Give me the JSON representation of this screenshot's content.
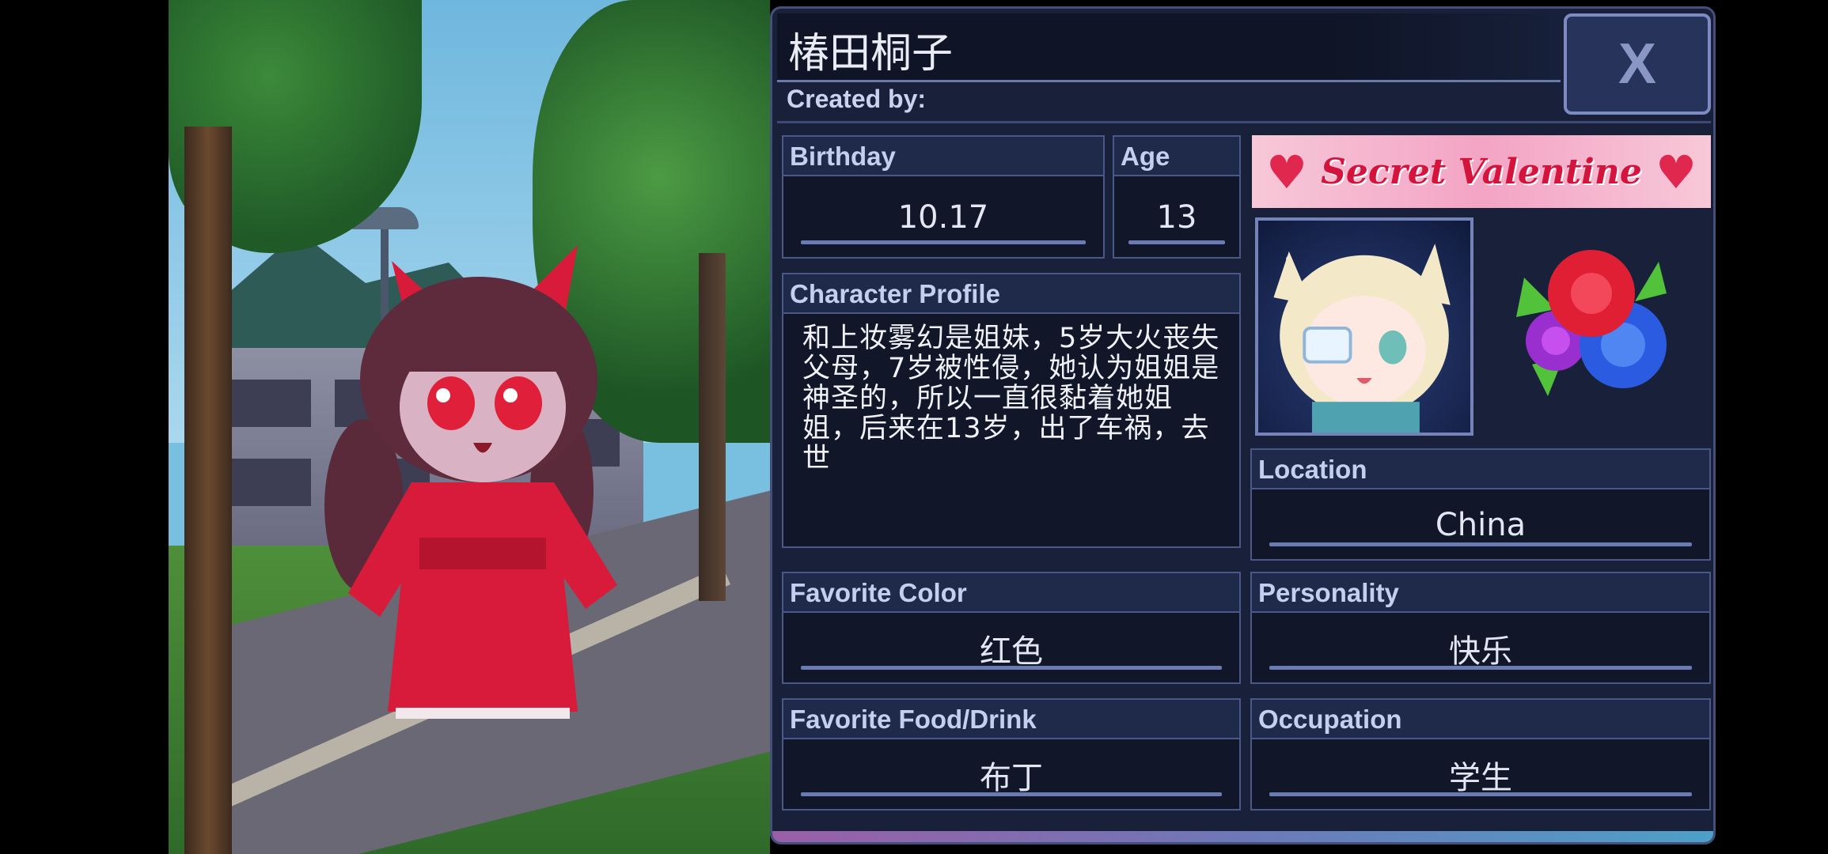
{
  "character_sheet": {
    "name": "椿田桐子",
    "created_by_label": "Created by:",
    "close_label": "X",
    "birthday": {
      "label": "Birthday",
      "value": "10.17"
    },
    "age": {
      "label": "Age",
      "value": "13"
    },
    "profile": {
      "label": "Character Profile",
      "text": "和上妆雾幻是姐妹，5岁大火丧失父母，7岁被性侵，她认为姐姐是神圣的，所以一直很黏着她姐姐，后来在13岁，出了车祸，去世"
    },
    "banner": {
      "text": "Secret Valentine"
    },
    "location": {
      "label": "Location",
      "value": "China"
    },
    "favorite_color": {
      "label": "Favorite Color",
      "value": "红色"
    },
    "personality": {
      "label": "Personality",
      "value": "快乐"
    },
    "favorite_food": {
      "label": "Favorite Food/Drink",
      "value": "布丁"
    },
    "occupation": {
      "label": "Occupation",
      "value": "学生"
    }
  },
  "colors": {
    "panel_bg": "#18203a",
    "field_bg": "#111729",
    "label_bg": "#1f2a4b",
    "accent": "#6a7bb4",
    "banner_text": "#d4143c",
    "kimono": "#d81b3a"
  },
  "icons": [
    "close-icon",
    "heart-icon",
    "rose-bouquet-icon"
  ]
}
